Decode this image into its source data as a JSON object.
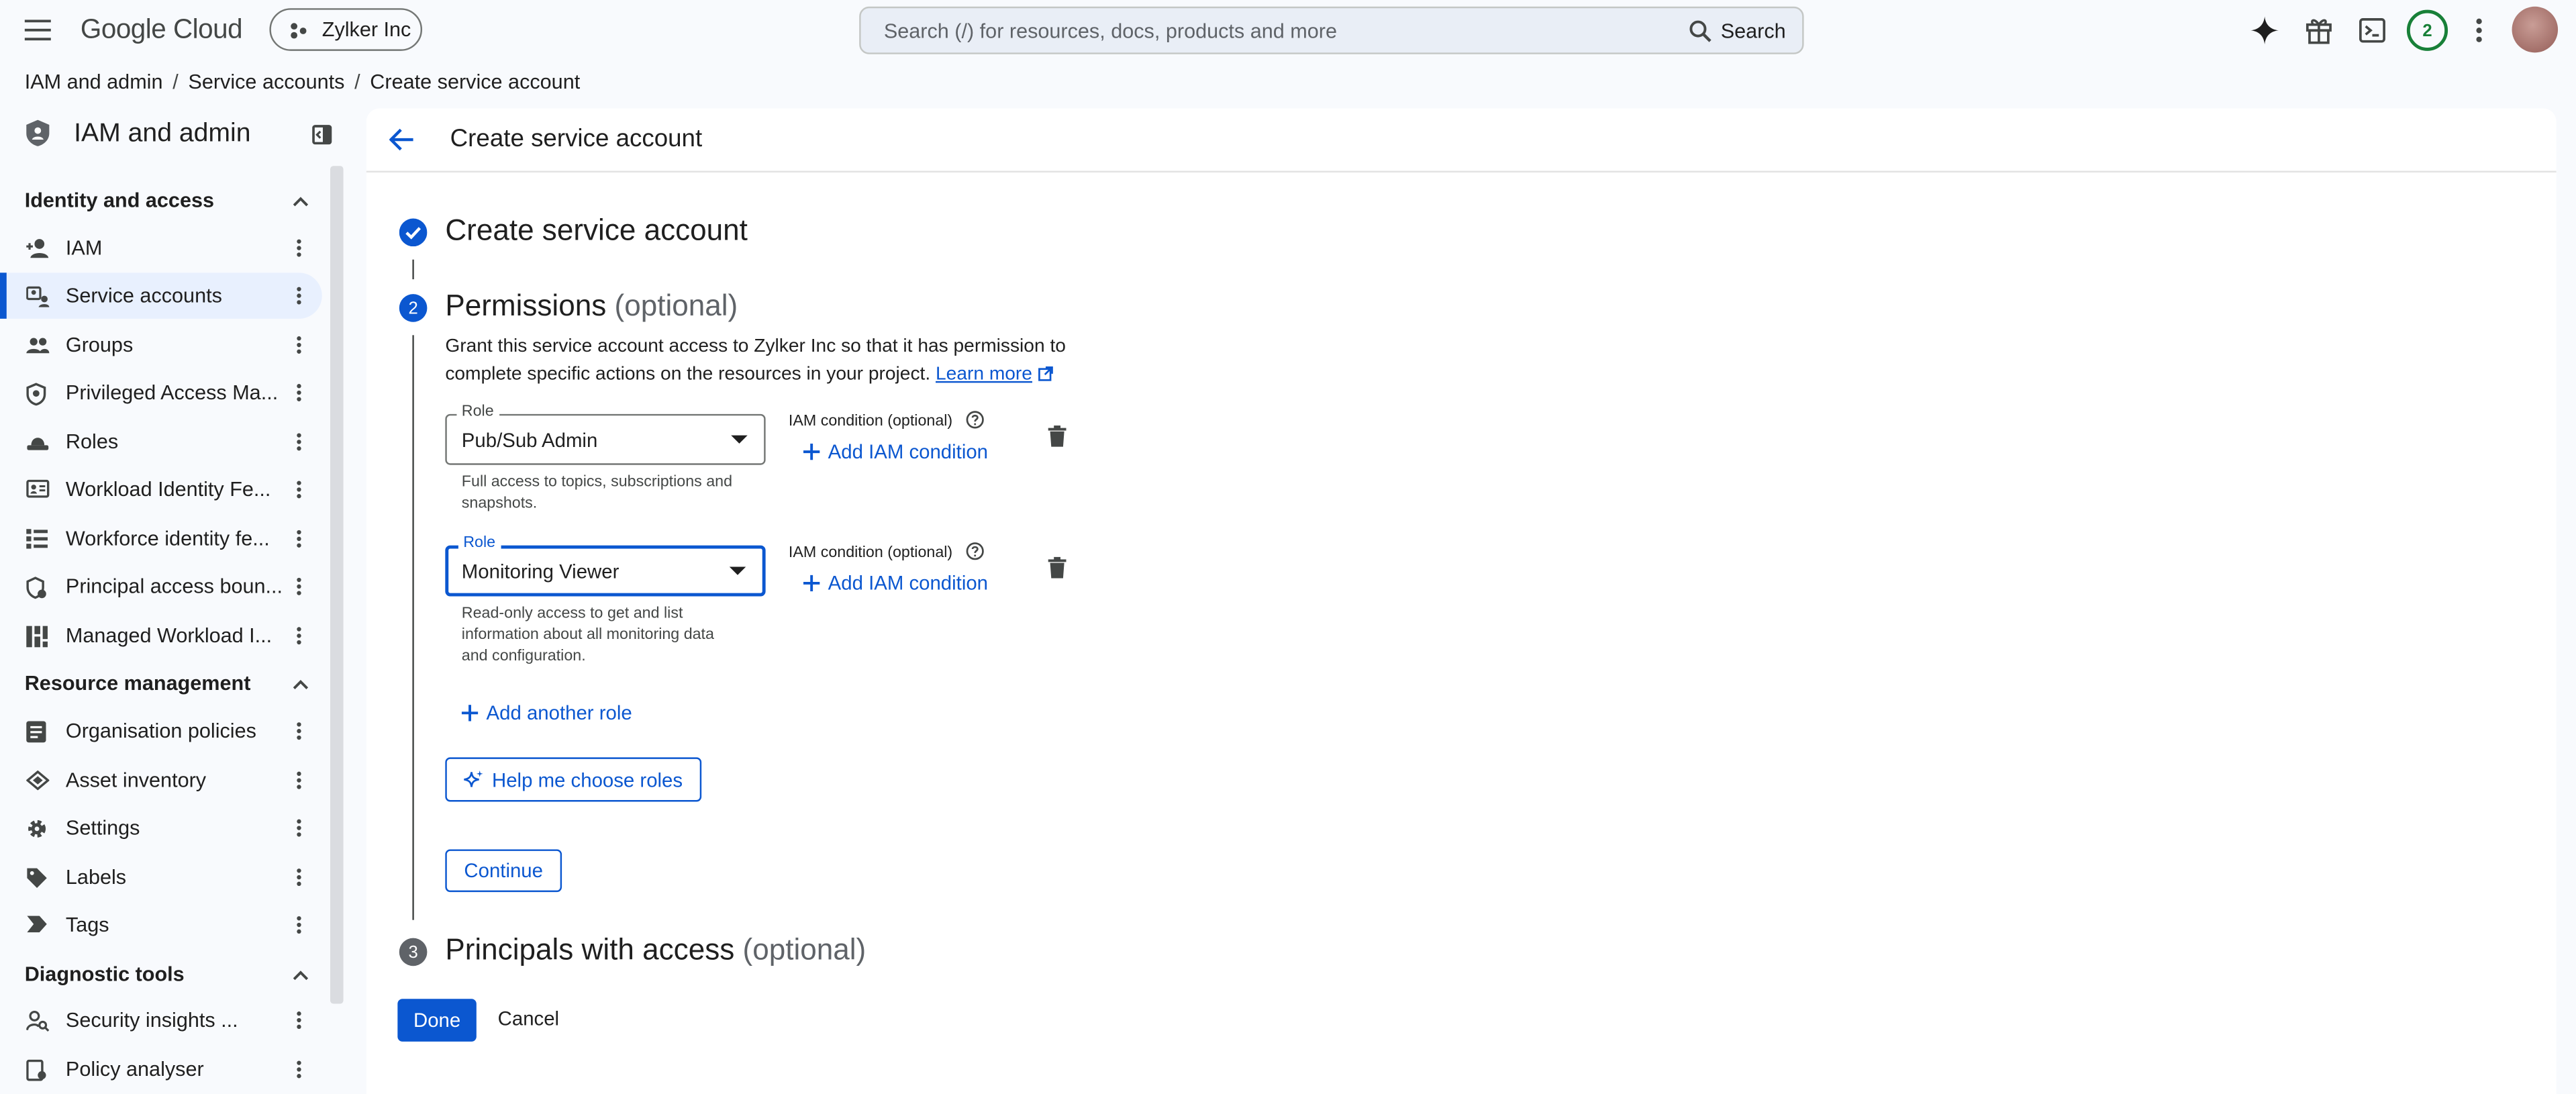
{
  "topbar": {
    "brand": "Google Cloud",
    "project": "Zylker Inc",
    "search_placeholder": "Search (/) for resources, docs, products and more",
    "search_button": "Search",
    "notification_count": "2"
  },
  "breadcrumbs": [
    "IAM and admin",
    "Service accounts",
    "Create service account"
  ],
  "sidebar": {
    "title": "IAM and admin",
    "sections": [
      {
        "title": "Identity and access"
      },
      {
        "title": "Resource management"
      },
      {
        "title": "Diagnostic tools"
      }
    ],
    "items": [
      {
        "label": "IAM",
        "icon": "person-add-icon"
      },
      {
        "label": "Service accounts",
        "icon": "service-account-icon"
      },
      {
        "label": "Groups",
        "icon": "group-icon"
      },
      {
        "label": "Privileged Access Ma...",
        "icon": "shield-icon"
      },
      {
        "label": "Roles",
        "icon": "hat-icon"
      },
      {
        "label": "Workload Identity Fe...",
        "icon": "id-card-icon"
      },
      {
        "label": "Workforce identity fe...",
        "icon": "list-icon"
      },
      {
        "label": "Principal access boun...",
        "icon": "shield-check-icon"
      },
      {
        "label": "Managed Workload I...",
        "icon": "grid-icon"
      },
      {
        "label": "Organisation policies",
        "icon": "policy-doc-icon"
      },
      {
        "label": "Asset inventory",
        "icon": "asset-icon"
      },
      {
        "label": "Settings",
        "icon": "gear-icon"
      },
      {
        "label": "Labels",
        "icon": "label-icon"
      },
      {
        "label": "Tags",
        "icon": "tag-icon"
      },
      {
        "label": "Security insights ...",
        "icon": "person-search-icon"
      },
      {
        "label": "Policy analyser",
        "icon": "policy-analyser-icon"
      }
    ]
  },
  "main": {
    "header_title": "Create service account",
    "step1": {
      "title": "Create service account"
    },
    "step2": {
      "number": "2",
      "title": "Permissions",
      "optional": "(optional)",
      "description": "Grant this service account access to Zylker Inc so that it has permission to complete specific actions on the resources in your project.",
      "learn_more": "Learn more",
      "roles": [
        {
          "label": "Role",
          "value": "Pub/Sub Admin",
          "hint": "Full access to topics, subscriptions and snapshots.",
          "condition_label": "IAM condition (optional)",
          "add_condition": "Add IAM condition"
        },
        {
          "label": "Role",
          "value": "Monitoring Viewer",
          "hint": "Read-only access to get and list information about all monitoring data and configuration.",
          "condition_label": "IAM condition (optional)",
          "add_condition": "Add IAM condition"
        }
      ],
      "add_role": "Add another role",
      "help_choose": "Help me choose roles",
      "continue": "Continue"
    },
    "step3": {
      "number": "3",
      "title": "Principals with access",
      "optional": "(optional)"
    },
    "done": "Done",
    "cancel": "Cancel"
  },
  "colors": {
    "accent": "#0b57d0",
    "active_bg": "#e8f0fe",
    "gemini": "#1f1f1f"
  }
}
